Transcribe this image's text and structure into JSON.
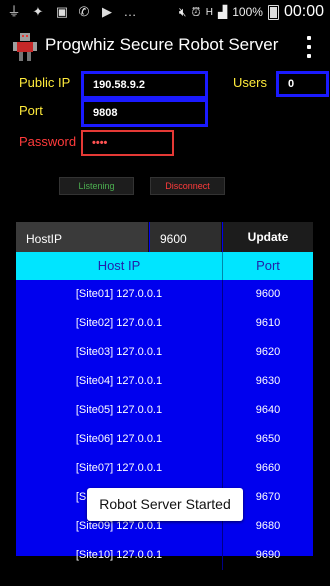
{
  "status_bar": {
    "battery": "100%",
    "time": "00:00",
    "network": "H"
  },
  "app": {
    "title": "Progwhiz Secure Robot Server"
  },
  "form": {
    "public_ip_label": "Public IP",
    "public_ip_value": "190.58.9.2",
    "users_label": "Users",
    "users_value": "0",
    "port_label": "Port",
    "port_value": "9808",
    "password_label": "Password",
    "password_value": "••••"
  },
  "buttons": {
    "listening": "Listening",
    "disconnect": "Disconnect"
  },
  "update_row": {
    "host_ip": "HostIP",
    "port": "9600",
    "update_label": "Update"
  },
  "table": {
    "headers": [
      "Host IP",
      "Port"
    ],
    "rows": [
      [
        "[Site01] 127.0.0.1",
        "9600"
      ],
      [
        "[Site02] 127.0.0.1",
        "9610"
      ],
      [
        "[Site03] 127.0.0.1",
        "9620"
      ],
      [
        "[Site04] 127.0.0.1",
        "9630"
      ],
      [
        "[Site05] 127.0.0.1",
        "9640"
      ],
      [
        "[Site06] 127.0.0.1",
        "9650"
      ],
      [
        "[Site07] 127.0.0.1",
        "9660"
      ],
      [
        "[Site08] 127.0.0.1",
        "9670"
      ],
      [
        "[Site09] 127.0.0.1",
        "9680"
      ],
      [
        "[Site10] 127.0.0.1",
        "9690"
      ]
    ]
  },
  "toast": {
    "message": "Robot Server Started"
  },
  "colors": {
    "label_yellow": "#ffeb3b",
    "label_red": "#ff3b3b",
    "field_border_blue": "#1a1aff",
    "table_blue": "#0000ee",
    "header_cyan": "#00e5ff"
  }
}
